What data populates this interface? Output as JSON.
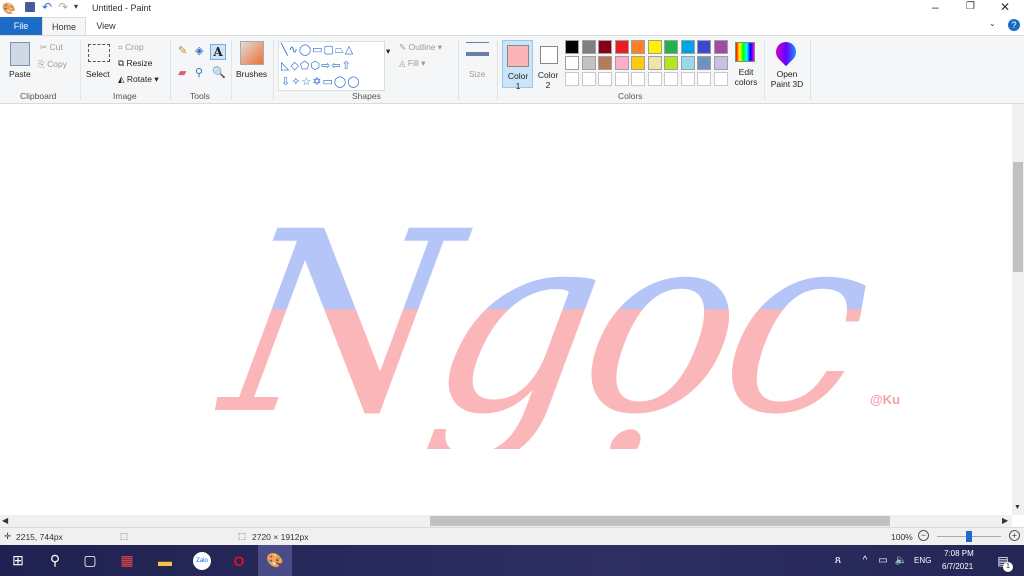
{
  "window": {
    "title": "Untitled - Paint"
  },
  "tabs": [
    "File",
    "Home",
    "View"
  ],
  "clipboard": {
    "paste": "Paste",
    "cut": "Cut",
    "copy": "Copy",
    "group": "Clipboard"
  },
  "image": {
    "select": "Select",
    "crop": "Crop",
    "resize": "Resize",
    "rotate": "Rotate",
    "group": "Image"
  },
  "tools": {
    "group": "Tools"
  },
  "brushes": {
    "label": "Brushes"
  },
  "shapes": {
    "outline": "Outline",
    "fill": "Fill",
    "group": "Shapes"
  },
  "size": {
    "label": "Size"
  },
  "colors": {
    "color1": "Color 1",
    "color2": "Color 2",
    "edit": "Edit colors",
    "group": "Colors",
    "color1_value": "#fbb4b8",
    "color2_value": "#ffffff",
    "palette_row1": [
      "#000000",
      "#7f7f7f",
      "#880015",
      "#ed1c24",
      "#ff7f27",
      "#fff200",
      "#22b14c",
      "#00a2e8",
      "#3f48cc",
      "#a349a4"
    ],
    "palette_row2": [
      "#ffffff",
      "#c3c3c3",
      "#b97a57",
      "#ffaec9",
      "#ffc90e",
      "#efe4b0",
      "#b5e61d",
      "#99d9ea",
      "#7092be",
      "#c8bfe7"
    ]
  },
  "paint3d": {
    "label": "Open Paint 3D"
  },
  "canvas": {
    "artwork_text": "Ngọc",
    "signature": "@Ku"
  },
  "status": {
    "cursor": "2215, 744px",
    "size": "2720 × 1912px",
    "zoom": "100%"
  },
  "taskbar": {
    "lang": "ENG",
    "time": "7:08 PM",
    "date": "6/7/2021",
    "notifications": "1"
  }
}
